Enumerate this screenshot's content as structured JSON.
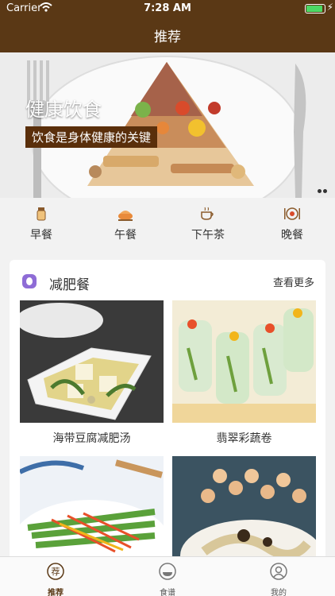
{
  "status_bar": {
    "carrier": "Carrier",
    "time": "7:28 AM"
  },
  "nav": {
    "title": "推荐"
  },
  "banner": {
    "title": "健康饮食",
    "subtitle": "饮食是身体健康的关键"
  },
  "categories": [
    {
      "label": "早餐",
      "icon": "bread-jar-icon"
    },
    {
      "label": "午餐",
      "icon": "roast-chicken-icon"
    },
    {
      "label": "下午茶",
      "icon": "tea-cup-icon"
    },
    {
      "label": "晚餐",
      "icon": "dinner-plate-icon"
    }
  ],
  "section": {
    "title": "减肥餐",
    "more_label": "查看更多",
    "icon": "leaf-badge-icon"
  },
  "recipes": [
    {
      "name": "海带豆腐减肥汤"
    },
    {
      "name": "翡翠彩蔬卷"
    },
    {
      "name": ""
    },
    {
      "name": ""
    }
  ],
  "tabs": [
    {
      "label": "推荐",
      "icon": "recommend-icon",
      "active": true
    },
    {
      "label": "食谱",
      "icon": "recipe-book-icon",
      "active": false
    },
    {
      "label": "我的",
      "icon": "profile-icon",
      "active": false
    }
  ],
  "colors": {
    "brand": "#5a3815",
    "accent_purple": "#8e6cd6"
  }
}
